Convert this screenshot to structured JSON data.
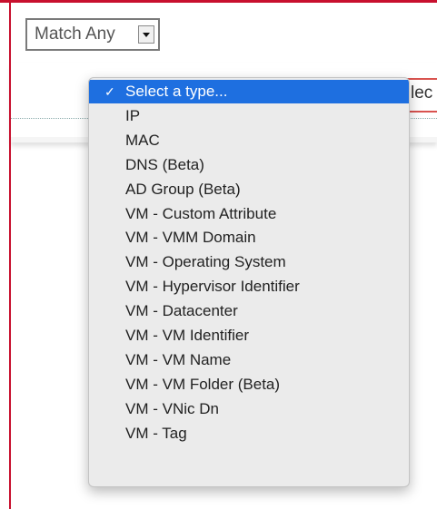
{
  "match_select": {
    "value": "Match Any"
  },
  "type_select": {
    "visible_text": "lec"
  },
  "dropdown": {
    "checkmark": "✓",
    "options": [
      {
        "label": "Select a type...",
        "selected": true
      },
      {
        "label": "IP"
      },
      {
        "label": "MAC"
      },
      {
        "label": "DNS (Beta)"
      },
      {
        "label": "AD Group (Beta)"
      },
      {
        "label": "VM - Custom Attribute"
      },
      {
        "label": "VM - VMM Domain"
      },
      {
        "label": "VM - Operating System"
      },
      {
        "label": "VM - Hypervisor Identifier"
      },
      {
        "label": "VM - Datacenter"
      },
      {
        "label": "VM - VM Identifier"
      },
      {
        "label": "VM - VM Name"
      },
      {
        "label": "VM - VM Folder (Beta)"
      },
      {
        "label": "VM - VNic Dn"
      },
      {
        "label": "VM - Tag"
      }
    ]
  },
  "colors": {
    "accent_border": "#c8102e",
    "selected_highlight": "#1e6fe0"
  }
}
